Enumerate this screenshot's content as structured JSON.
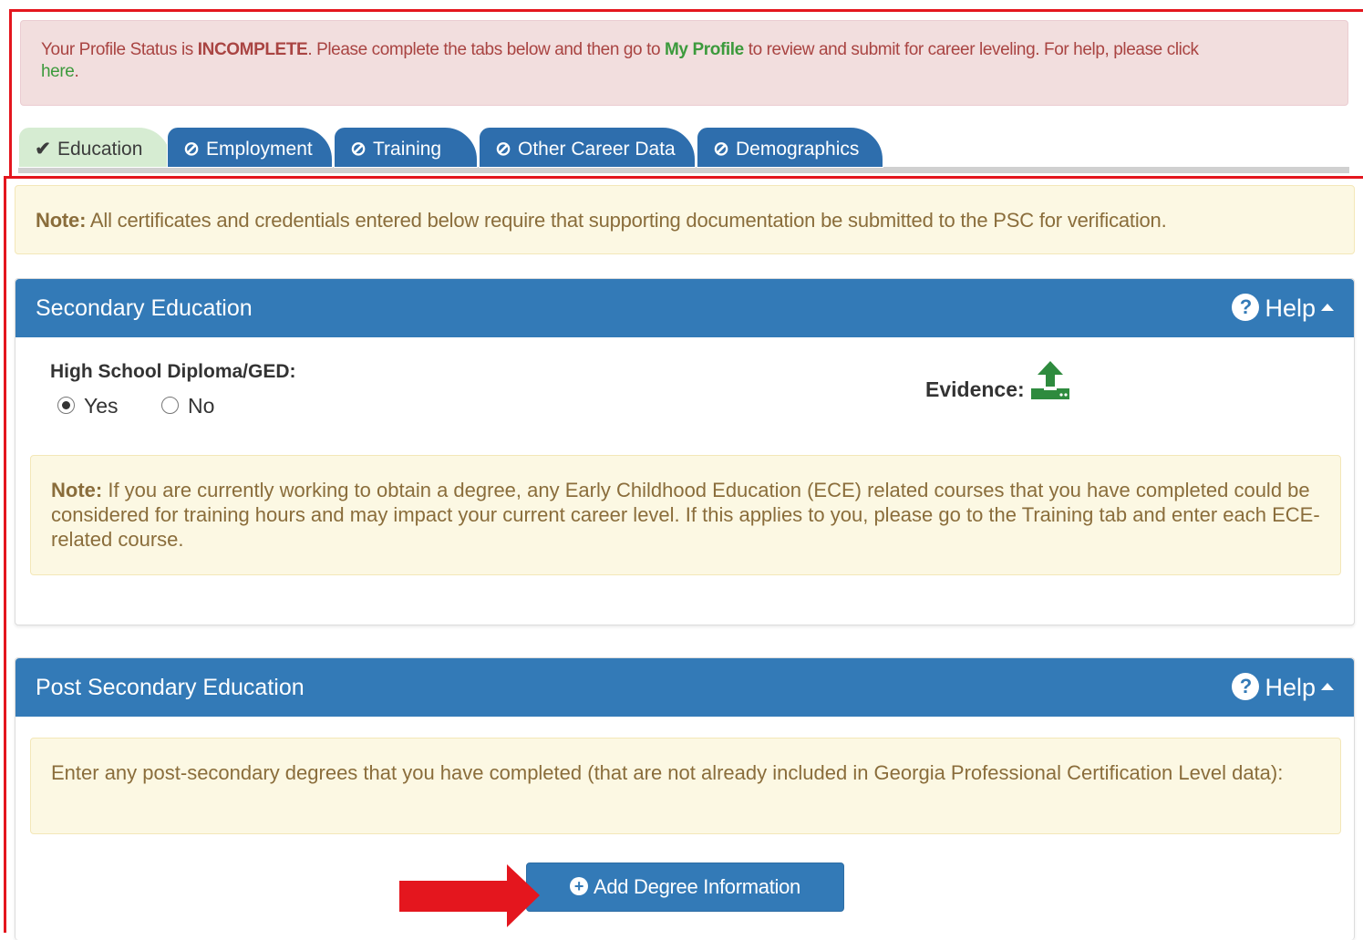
{
  "status_alert": {
    "prefix": "Your Profile Status is ",
    "status": "INCOMPLETE",
    "middle": ". Please complete the tabs below and then go to ",
    "my_profile_link": "My Profile",
    "suffix": " to review and submit for career leveling. For help, please click",
    "here_link": "here",
    "end": "."
  },
  "tabs": [
    {
      "label": "Education",
      "icon": "check-icon",
      "state": "complete"
    },
    {
      "label": "Employment",
      "icon": "ban-icon",
      "state": "incomplete"
    },
    {
      "label": "Training",
      "icon": "ban-icon",
      "state": "incomplete"
    },
    {
      "label": "Other Career Data",
      "icon": "ban-icon",
      "state": "incomplete"
    },
    {
      "label": "Demographics",
      "icon": "ban-icon",
      "state": "incomplete"
    }
  ],
  "top_note": {
    "label": "Note:",
    "text": " All certificates and credentials entered below require that supporting documentation be submitted to the PSC for verification."
  },
  "secondary": {
    "title": "Secondary Education",
    "help": "Help",
    "field_label": "High School Diploma/GED:",
    "options": [
      "Yes",
      "No"
    ],
    "selected": "Yes",
    "evidence_label": "Evidence:",
    "note_label": "Note:",
    "note_text": " If you are currently working to obtain a degree, any Early Childhood Education (ECE) related courses that you have completed could be considered for training hours and may impact your current career level. If this applies to you, please go to the Training tab and enter each ECE-related course."
  },
  "post_secondary": {
    "title": "Post Secondary Education",
    "help": "Help",
    "note_text": "Enter any post-secondary degrees that you have completed (that are not already included in Georgia Professional Certification Level data):",
    "add_button": "Add Degree Information"
  },
  "colors": {
    "panel_blue": "#337ab7",
    "tab_blue": "#2e6ead",
    "alert_red": "#a94442",
    "note_text": "#8a6d3b",
    "annotation_red": "#e4161e",
    "upload_green": "#2e8b3e"
  }
}
